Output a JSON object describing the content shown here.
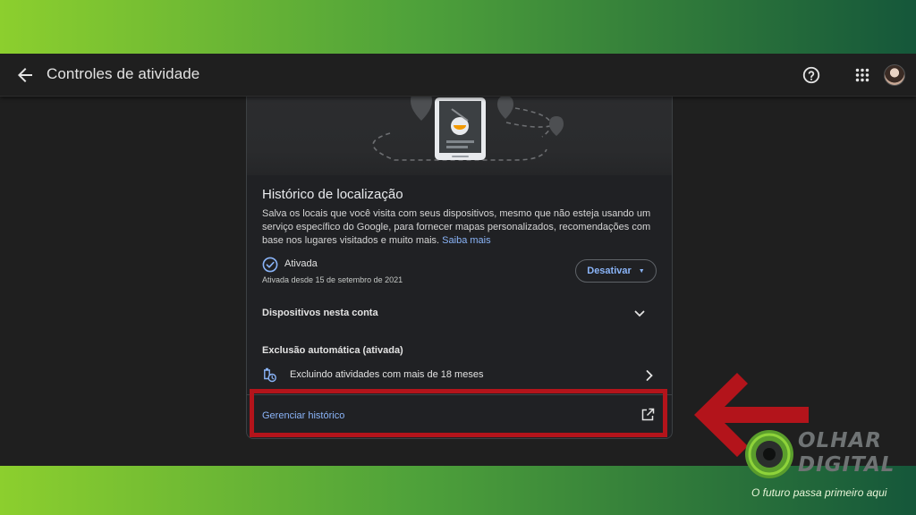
{
  "app_bar": {
    "title": "Controles de atividade",
    "icons": {
      "back": "arrow-back-icon",
      "help": "help-circle-icon",
      "apps": "apps-grid-icon",
      "account": "account-avatar"
    }
  },
  "card": {
    "title": "Histórico de localização",
    "description": "Salva os locais que você visita com seus dispositivos, mesmo que não esteja usando um serviço específico do Google, para fornecer mapas personalizados, recomendações com base nos lugares visitados e muito mais.",
    "learn_more": "Saiba mais",
    "status": {
      "label": "Ativada",
      "since": "Ativada desde 15 de setembro de 2021",
      "icon": "check-circle-icon"
    },
    "deactivate_button": "Desativar",
    "devices_section": {
      "label": "Dispositivos nesta conta",
      "icon": "chevron-down-icon"
    },
    "auto_delete": {
      "title": "Exclusão automática (ativada)",
      "item_label": "Excluindo atividades com mais de 18 meses",
      "icon": "auto-delete-icon"
    },
    "manage_history": {
      "label": "Gerenciar histórico",
      "icon": "open-in-new-icon"
    }
  },
  "annotations": {
    "highlight_color": "#b3141b",
    "arrow_color": "#b3141b"
  },
  "watermark": {
    "brand_line1": "OLHAR",
    "brand_line2": "DIGITAL",
    "slogan": "O futuro passa primeiro aqui"
  },
  "colors": {
    "background": "#1f1f1f",
    "card": "#202124",
    "link": "#8ab4f8",
    "band_light": "#8ccf2e",
    "band_dark": "#15573a"
  }
}
